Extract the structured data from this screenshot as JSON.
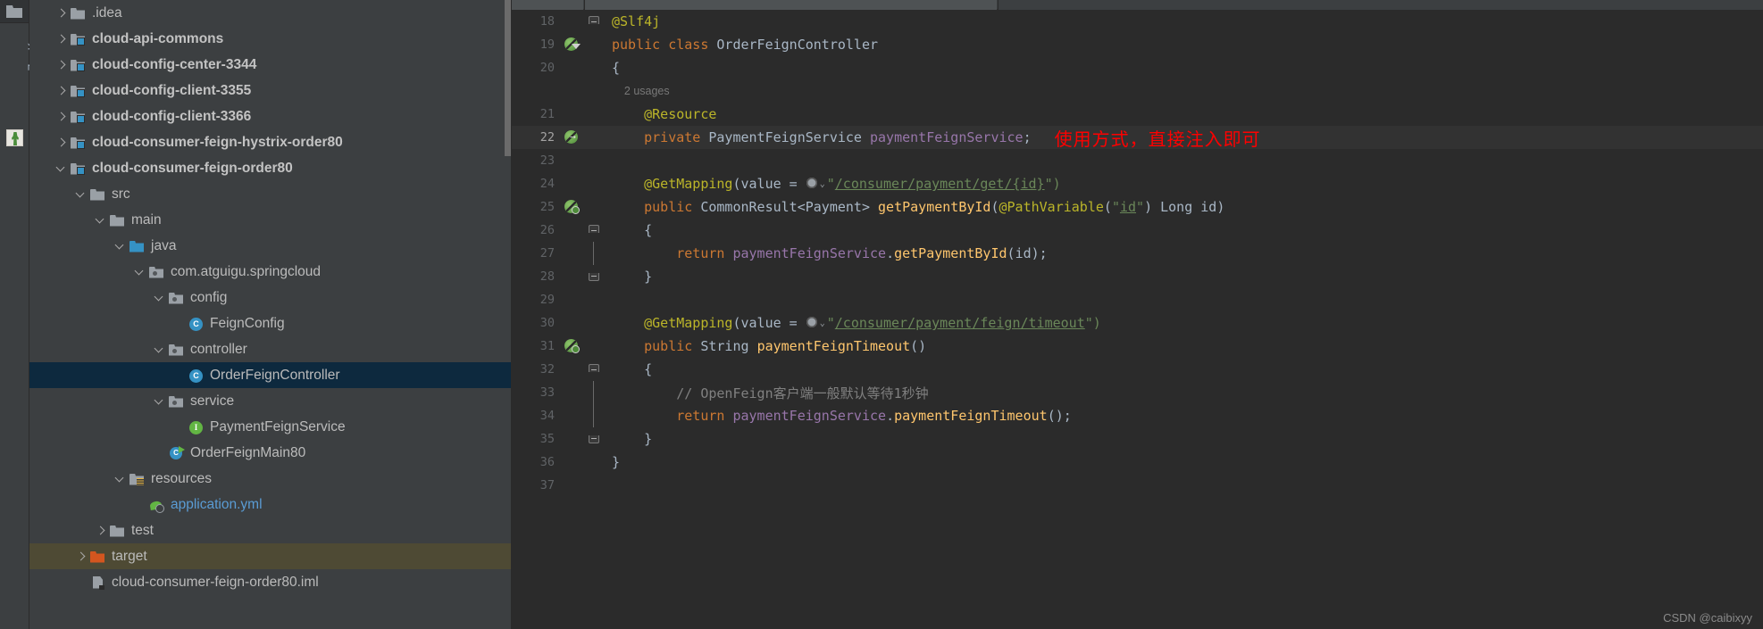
{
  "toolwindow": {
    "vertical_label": "ZooKeeper",
    "folder_icon": "folder-icon",
    "zookeeper_icon": "zookeeper-icon"
  },
  "project_tree": {
    "items": [
      {
        "label": ".idea",
        "depth": 1,
        "arrow": "right",
        "icon": "folder-plain-icon",
        "bold": false,
        "state": "normal"
      },
      {
        "label": "cloud-api-commons",
        "depth": 1,
        "arrow": "right",
        "icon": "folder-module-icon",
        "bold": true,
        "state": "normal"
      },
      {
        "label": "cloud-config-center-3344",
        "depth": 1,
        "arrow": "right",
        "icon": "folder-module-icon",
        "bold": true,
        "state": "normal"
      },
      {
        "label": "cloud-config-client-3355",
        "depth": 1,
        "arrow": "right",
        "icon": "folder-module-icon",
        "bold": true,
        "state": "normal"
      },
      {
        "label": "cloud-config-client-3366",
        "depth": 1,
        "arrow": "right",
        "icon": "folder-module-icon",
        "bold": true,
        "state": "normal"
      },
      {
        "label": "cloud-consumer-feign-hystrix-order80",
        "depth": 1,
        "arrow": "right",
        "icon": "folder-module-icon",
        "bold": true,
        "state": "normal"
      },
      {
        "label": "cloud-consumer-feign-order80",
        "depth": 1,
        "arrow": "down",
        "icon": "folder-module-icon",
        "bold": true,
        "state": "normal"
      },
      {
        "label": "src",
        "depth": 2,
        "arrow": "down",
        "icon": "folder-plain-icon",
        "bold": false,
        "state": "normal"
      },
      {
        "label": "main",
        "depth": 3,
        "arrow": "down",
        "icon": "folder-plain-icon",
        "bold": false,
        "state": "normal"
      },
      {
        "label": "java",
        "depth": 4,
        "arrow": "down",
        "icon": "folder-source-icon",
        "bold": false,
        "state": "normal"
      },
      {
        "label": "com.atguigu.springcloud",
        "depth": 5,
        "arrow": "down",
        "icon": "folder-package-icon",
        "bold": false,
        "state": "normal"
      },
      {
        "label": "config",
        "depth": 6,
        "arrow": "down",
        "icon": "folder-package-icon",
        "bold": false,
        "state": "normal"
      },
      {
        "label": "FeignConfig",
        "depth": 7,
        "arrow": "none",
        "icon": "java-class-icon",
        "bold": false,
        "state": "normal"
      },
      {
        "label": "controller",
        "depth": 6,
        "arrow": "down",
        "icon": "folder-package-icon",
        "bold": false,
        "state": "normal"
      },
      {
        "label": "OrderFeignController",
        "depth": 7,
        "arrow": "none",
        "icon": "java-class-icon",
        "bold": false,
        "state": "selected"
      },
      {
        "label": "service",
        "depth": 6,
        "arrow": "down",
        "icon": "folder-package-icon",
        "bold": false,
        "state": "normal"
      },
      {
        "label": "PaymentFeignService",
        "depth": 7,
        "arrow": "none",
        "icon": "java-interface-icon",
        "bold": false,
        "state": "normal"
      },
      {
        "label": "OrderFeignMain80",
        "depth": 6,
        "arrow": "none",
        "icon": "java-main-class-icon",
        "bold": false,
        "state": "normal"
      },
      {
        "label": "resources",
        "depth": 4,
        "arrow": "down",
        "icon": "folder-resources-icon",
        "bold": false,
        "state": "normal"
      },
      {
        "label": "application.yml",
        "depth": 5,
        "arrow": "none",
        "icon": "spring-yaml-icon",
        "bold": false,
        "state": "link"
      },
      {
        "label": "test",
        "depth": 3,
        "arrow": "right",
        "icon": "folder-plain-icon",
        "bold": false,
        "state": "normal"
      },
      {
        "label": "target",
        "depth": 2,
        "arrow": "right",
        "icon": "folder-target-icon",
        "bold": false,
        "state": "highlighted"
      },
      {
        "label": "cloud-consumer-feign-order80.iml",
        "depth": 2,
        "arrow": "none",
        "icon": "iml-file-icon",
        "bold": false,
        "state": "normal"
      }
    ]
  },
  "editor": {
    "annotation": "使用方式，直接注入即可",
    "lines": [
      {
        "num": "18",
        "gutter_icon": "",
        "fold": "fold-top",
        "tokens": [
          {
            "t": "@Slf4j",
            "c": "anno"
          }
        ]
      },
      {
        "num": "19",
        "gutter_icon": "spring-bean-icon",
        "fold": "",
        "tokens": [
          {
            "t": "public",
            "c": "kw"
          },
          {
            "t": " ",
            "c": "punc"
          },
          {
            "t": "class",
            "c": "kw"
          },
          {
            "t": " ",
            "c": "punc"
          },
          {
            "t": "OrderFeignController",
            "c": "cls"
          }
        ]
      },
      {
        "num": "20",
        "gutter_icon": "",
        "fold": "",
        "tokens": [
          {
            "t": "{",
            "c": "brace"
          }
        ]
      },
      {
        "num": "",
        "gutter_icon": "",
        "fold": "",
        "tokens": [
          {
            "t": "    2 usages",
            "c": "usages"
          }
        ]
      },
      {
        "num": "21",
        "gutter_icon": "",
        "fold": "",
        "tokens": [
          {
            "t": "    @Resource",
            "c": "anno"
          }
        ]
      },
      {
        "num": "22",
        "gutter_icon": "spring-bean-autowired-icon",
        "fold": "",
        "current": true,
        "tokens": [
          {
            "t": "    private",
            "c": "kw"
          },
          {
            "t": " ",
            "c": "punc"
          },
          {
            "t": "PaymentFeignService",
            "c": "cls"
          },
          {
            "t": " ",
            "c": "punc"
          },
          {
            "t": "paymentFeignService",
            "c": "field"
          },
          {
            "t": ";",
            "c": "punc"
          }
        ]
      },
      {
        "num": "23",
        "gutter_icon": "",
        "fold": "",
        "tokens": []
      },
      {
        "num": "24",
        "gutter_icon": "",
        "fold": "",
        "tokens": [
          {
            "t": "    @GetMapping",
            "c": "anno"
          },
          {
            "t": "(",
            "c": "punc"
          },
          {
            "t": "value",
            "c": "ident"
          },
          {
            "t": " = ",
            "c": "punc"
          },
          {
            "t": "GLOBE",
            "c": "globe"
          },
          {
            "t": "\"",
            "c": "str"
          },
          {
            "t": "/consumer/payment/get/{id}",
            "c": "strlink"
          },
          {
            "t": "\")",
            "c": "str"
          }
        ]
      },
      {
        "num": "25",
        "gutter_icon": "spring-endpoint-icon",
        "fold": "",
        "tokens": [
          {
            "t": "    public",
            "c": "kw"
          },
          {
            "t": " ",
            "c": "punc"
          },
          {
            "t": "CommonResult<Payment>",
            "c": "cls"
          },
          {
            "t": " ",
            "c": "punc"
          },
          {
            "t": "getPaymentById",
            "c": "fn"
          },
          {
            "t": "(",
            "c": "punc"
          },
          {
            "t": "@PathVariable",
            "c": "anno"
          },
          {
            "t": "(",
            "c": "punc"
          },
          {
            "t": "\"",
            "c": "str"
          },
          {
            "t": "id",
            "c": "idlink"
          },
          {
            "t": "\"",
            "c": "str"
          },
          {
            "t": ") ",
            "c": "punc"
          },
          {
            "t": "Long",
            "c": "cls"
          },
          {
            "t": " ",
            "c": "punc"
          },
          {
            "t": "id",
            "c": "ident"
          },
          {
            "t": ")",
            "c": "punc"
          }
        ]
      },
      {
        "num": "26",
        "gutter_icon": "",
        "fold": "fold-top",
        "tokens": [
          {
            "t": "    {",
            "c": "brace"
          }
        ]
      },
      {
        "num": "27",
        "gutter_icon": "",
        "fold": "fold-line",
        "tokens": [
          {
            "t": "        return",
            "c": "kw"
          },
          {
            "t": " ",
            "c": "punc"
          },
          {
            "t": "paymentFeignService",
            "c": "field"
          },
          {
            "t": ".",
            "c": "punc"
          },
          {
            "t": "getPaymentById",
            "c": "fn"
          },
          {
            "t": "(",
            "c": "punc"
          },
          {
            "t": "id",
            "c": "ident"
          },
          {
            "t": ");",
            "c": "punc"
          }
        ]
      },
      {
        "num": "28",
        "gutter_icon": "",
        "fold": "fold-bot",
        "tokens": [
          {
            "t": "    }",
            "c": "brace"
          }
        ]
      },
      {
        "num": "29",
        "gutter_icon": "",
        "fold": "",
        "tokens": []
      },
      {
        "num": "30",
        "gutter_icon": "",
        "fold": "",
        "tokens": [
          {
            "t": "    @GetMapping",
            "c": "anno"
          },
          {
            "t": "(",
            "c": "punc"
          },
          {
            "t": "value",
            "c": "ident"
          },
          {
            "t": " = ",
            "c": "punc"
          },
          {
            "t": "GLOBE",
            "c": "globe"
          },
          {
            "t": "\"",
            "c": "str"
          },
          {
            "t": "/consumer/payment/feign/timeout",
            "c": "strlink"
          },
          {
            "t": "\")",
            "c": "str"
          }
        ]
      },
      {
        "num": "31",
        "gutter_icon": "spring-endpoint-icon",
        "fold": "",
        "tokens": [
          {
            "t": "    public",
            "c": "kw"
          },
          {
            "t": " ",
            "c": "punc"
          },
          {
            "t": "String",
            "c": "cls"
          },
          {
            "t": " ",
            "c": "punc"
          },
          {
            "t": "paymentFeignTimeout",
            "c": "fn"
          },
          {
            "t": "()",
            "c": "punc"
          }
        ]
      },
      {
        "num": "32",
        "gutter_icon": "",
        "fold": "fold-top",
        "tokens": [
          {
            "t": "    {",
            "c": "brace"
          }
        ]
      },
      {
        "num": "33",
        "gutter_icon": "",
        "fold": "fold-line",
        "tokens": [
          {
            "t": "        // OpenFeign客户端一般默认等待1秒钟",
            "c": "cmt"
          }
        ]
      },
      {
        "num": "34",
        "gutter_icon": "",
        "fold": "fold-line",
        "tokens": [
          {
            "t": "        return",
            "c": "kw"
          },
          {
            "t": " ",
            "c": "punc"
          },
          {
            "t": "paymentFeignService",
            "c": "field"
          },
          {
            "t": ".",
            "c": "punc"
          },
          {
            "t": "paymentFeignTimeout",
            "c": "fn"
          },
          {
            "t": "();",
            "c": "punc"
          }
        ]
      },
      {
        "num": "35",
        "gutter_icon": "",
        "fold": "fold-bot",
        "tokens": [
          {
            "t": "    }",
            "c": "brace"
          }
        ]
      },
      {
        "num": "36",
        "gutter_icon": "",
        "fold": "",
        "tokens": [
          {
            "t": "}",
            "c": "brace"
          }
        ]
      },
      {
        "num": "37",
        "gutter_icon": "",
        "fold": "",
        "tokens": []
      }
    ]
  },
  "watermark": "CSDN @caibixyy"
}
